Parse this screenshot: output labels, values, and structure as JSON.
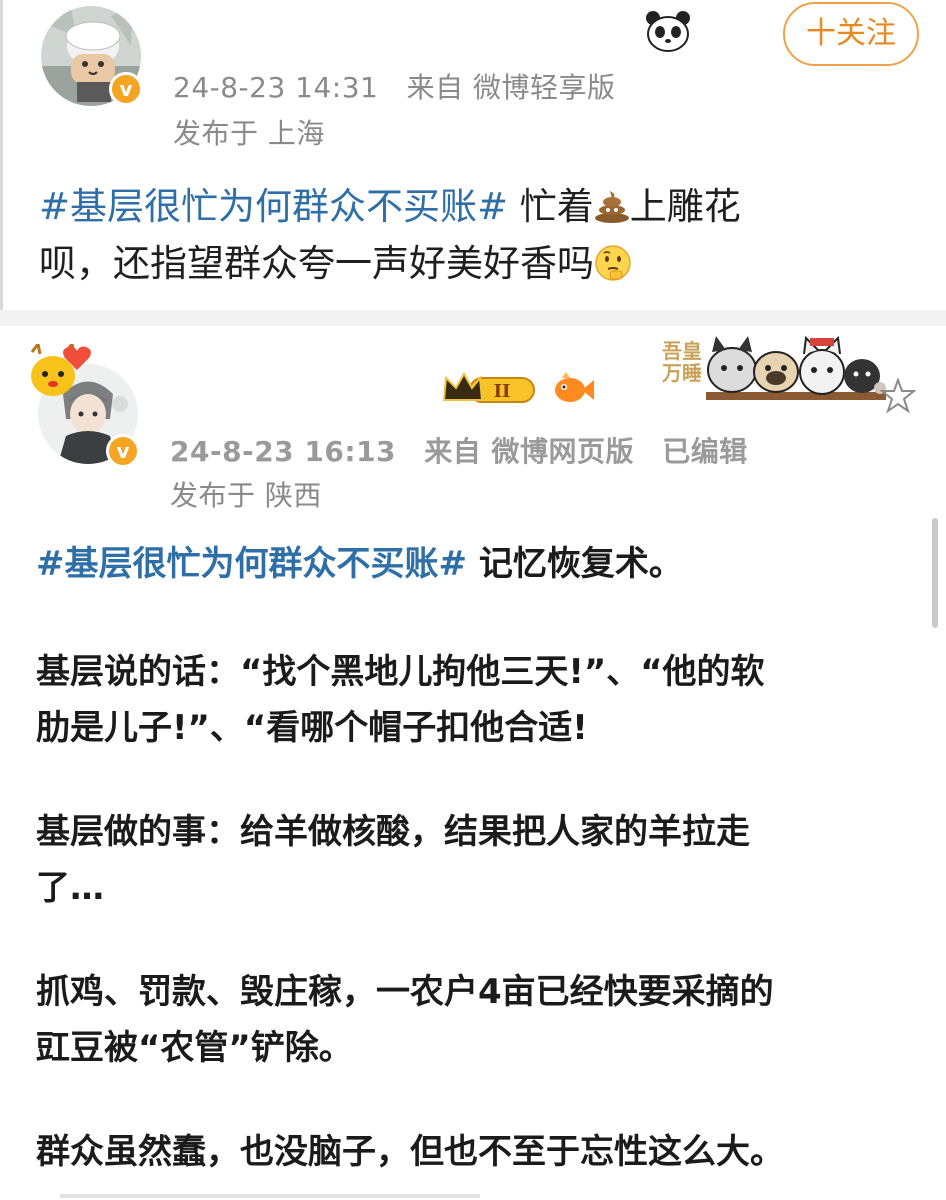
{
  "post1": {
    "timestamp": "24-8-23 14:31",
    "source": "来自 微博轻享版",
    "location": "发布于 上海",
    "follow_label": "十关注",
    "hashtag": "#基层很忙为何群众不买账#",
    "text_a": "忙着",
    "text_b": "上雕花",
    "text_c": "呗，还指望群众夸一声好美好香吗"
  },
  "post2": {
    "timestamp": "24-8-23 16:13",
    "source": "来自 微博网页版",
    "edited": "已编辑",
    "location": "发布于 陕西",
    "sticker_text": "吾皇万睡",
    "hashtag": "#基层很忙为何群众不买账#",
    "line1_rest": "记忆恢复术。",
    "para1_l1": "基层说的话：“找个黑地儿拘他三天!”、“他的软",
    "para1_l2": "肋是儿子!”、“看哪个帽子扣他合适!",
    "para2_l1": "基层做的事：给羊做核酸，结果把人家的羊拉走",
    "para2_l2": "了…",
    "para3_l1": "抓鸡、罚款、毁庄稼，一农户4亩已经快要采摘的",
    "para3_l2": "豇豆被“农管”铲除。",
    "para4_l1": "群众虽然蠢，也没脑子，但也不至于忘性这么大。"
  },
  "colors": {
    "hashtag": "#2f6fa8",
    "follow": "#e8881f",
    "verified": "#f6a523",
    "meta": "#8a8a8a"
  },
  "icons": [
    "verified-icon",
    "panda-icon",
    "poop-emoji-icon",
    "thinking-emoji-icon",
    "crown-badge-icon",
    "fish-icon",
    "star-icon",
    "pet-sticker-icon"
  ]
}
